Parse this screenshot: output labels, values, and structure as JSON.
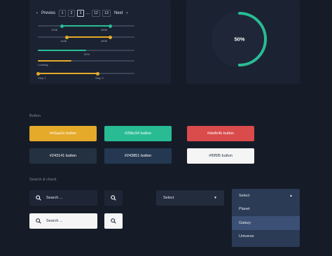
{
  "pagination": {
    "prev": "Previos",
    "next": "Next",
    "pages": [
      "1",
      "2",
      "3",
      "...",
      "12",
      "13"
    ],
    "active_page": "3"
  },
  "sliders": {
    "range1": {
      "min_label": "100$",
      "max_label": "450$",
      "from": 0.25,
      "to": 0.75
    },
    "range2": {
      "min_label": "140$",
      "max_label": "450$",
      "from": 0.3,
      "to": 0.75
    },
    "progress": {
      "label": "50%",
      "value": 0.5
    },
    "loading": {
      "label": "Loading...",
      "value": 0.35
    },
    "steps": {
      "step1": "Step 1",
      "step2": "Step 2",
      "value": 0.62
    }
  },
  "donut": {
    "label": "50%",
    "value": 0.5,
    "color": "#29bc94"
  },
  "buttons_section": {
    "title": "Button",
    "items": [
      {
        "label": "#e5aa2a button",
        "color": "#e5aa2a"
      },
      {
        "label": "#29bc94 button",
        "color": "#29bc94"
      },
      {
        "label": "#da4b4b button",
        "color": "#da4b4b"
      },
      {
        "label": "#243141 button",
        "color": "#243141"
      },
      {
        "label": "#243851 button",
        "color": "#243851"
      },
      {
        "label": "#f5f5f5 button",
        "color": "#f5f5f5"
      }
    ]
  },
  "search_section": {
    "title": "Search & check",
    "dark_placeholder": "Search ...",
    "light_placeholder": "Search ...",
    "select_closed": "Select",
    "select_open": {
      "value": "Select",
      "options": [
        "Planet",
        "Galaxy",
        "Universe"
      ],
      "highlighted": "Galaxy"
    }
  }
}
